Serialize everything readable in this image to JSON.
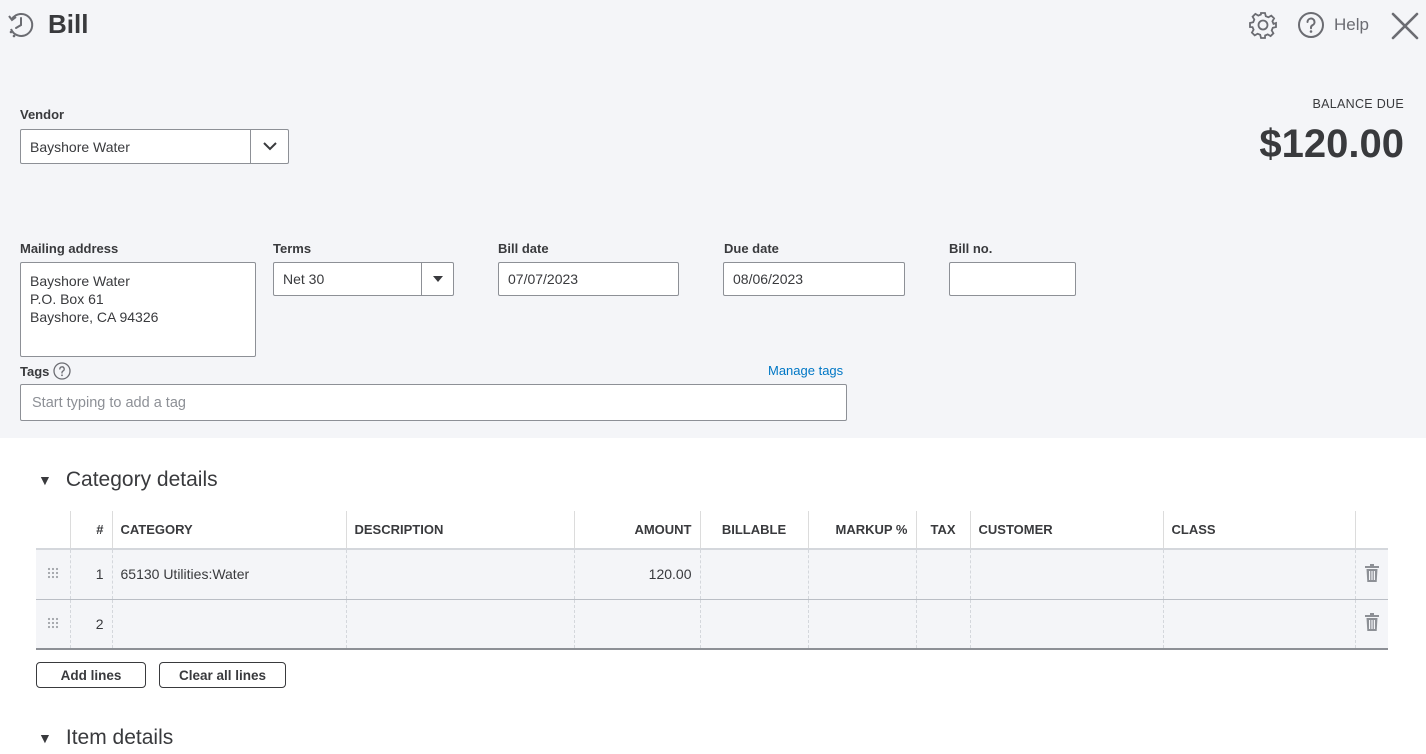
{
  "header": {
    "title": "Bill",
    "help_label": "Help"
  },
  "balance": {
    "label": "BALANCE DUE",
    "amount": "$120.00"
  },
  "vendor": {
    "label": "Vendor",
    "value": "Bayshore Water"
  },
  "mailing_address": {
    "label": "Mailing address",
    "lines": [
      "Bayshore Water",
      "P.O. Box 61",
      "Bayshore, CA  94326"
    ]
  },
  "terms": {
    "label": "Terms",
    "value": "Net 30"
  },
  "bill_date": {
    "label": "Bill date",
    "value": "07/07/2023"
  },
  "due_date": {
    "label": "Due date",
    "value": "08/06/2023"
  },
  "bill_no": {
    "label": "Bill no.",
    "value": ""
  },
  "tags": {
    "label": "Tags",
    "manage_label": "Manage tags",
    "placeholder": "Start typing to add a tag"
  },
  "category_details": {
    "title": "Category details",
    "columns": [
      "#",
      "CATEGORY",
      "DESCRIPTION",
      "AMOUNT",
      "BILLABLE",
      "MARKUP %",
      "TAX",
      "CUSTOMER",
      "CLASS"
    ],
    "rows": [
      {
        "num": "1",
        "category": "65130 Utilities:Water",
        "description": "",
        "amount": "120.00",
        "billable": "",
        "markup": "",
        "tax": "",
        "customer": "",
        "class": ""
      },
      {
        "num": "2",
        "category": "",
        "description": "",
        "amount": "",
        "billable": "",
        "markup": "",
        "tax": "",
        "customer": "",
        "class": ""
      }
    ],
    "add_lines_label": "Add lines",
    "clear_lines_label": "Clear all lines"
  },
  "item_details": {
    "title": "Item details"
  },
  "colors": {
    "background_top": "#f4f5f8",
    "text": "#393a3d",
    "link": "#0077c5",
    "border": "#8d9096"
  }
}
